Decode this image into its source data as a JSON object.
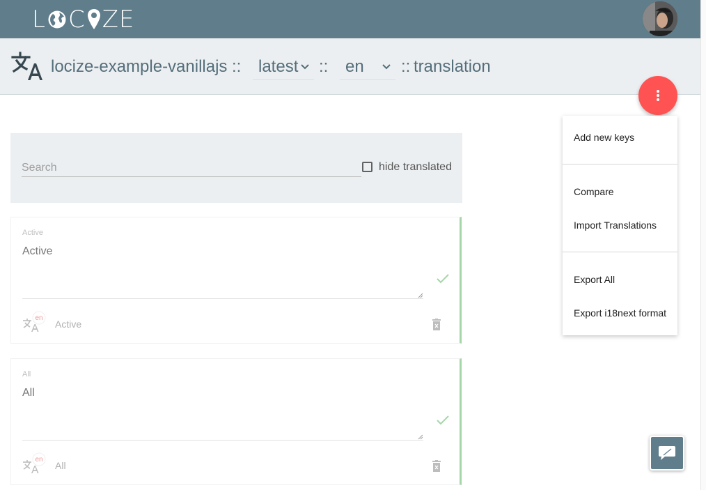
{
  "navbar": {
    "logo_letters": [
      "L",
      "C",
      "Z",
      "E"
    ],
    "logo_text": "LOCIZE",
    "bg_color": "#607d8b"
  },
  "header": {
    "project": "locize-example-vanillajs",
    "sep1": "::",
    "version": "latest",
    "sep2": "::",
    "language": "en",
    "sep3": "::",
    "namespace": "translation"
  },
  "fab": {
    "icon": "more-vert-icon",
    "color": "#ff5252"
  },
  "menu": {
    "items": [
      "Add new keys",
      "Compare",
      "Import Translations",
      "Export All",
      "Export i18next format"
    ]
  },
  "search": {
    "placeholder": "Search",
    "value": "",
    "hide_translated_label": "hide translated",
    "hide_translated_checked": false
  },
  "cards": [
    {
      "key": "Active",
      "value": "Active",
      "lang_badge": "en",
      "source": "Active",
      "status": "saved"
    },
    {
      "key": "All",
      "value": "All",
      "lang_badge": "en",
      "source": "All",
      "status": "saved"
    }
  ],
  "colors": {
    "accent": "#607d8b",
    "success": "#a5d6a7",
    "danger": "#ff5252"
  }
}
